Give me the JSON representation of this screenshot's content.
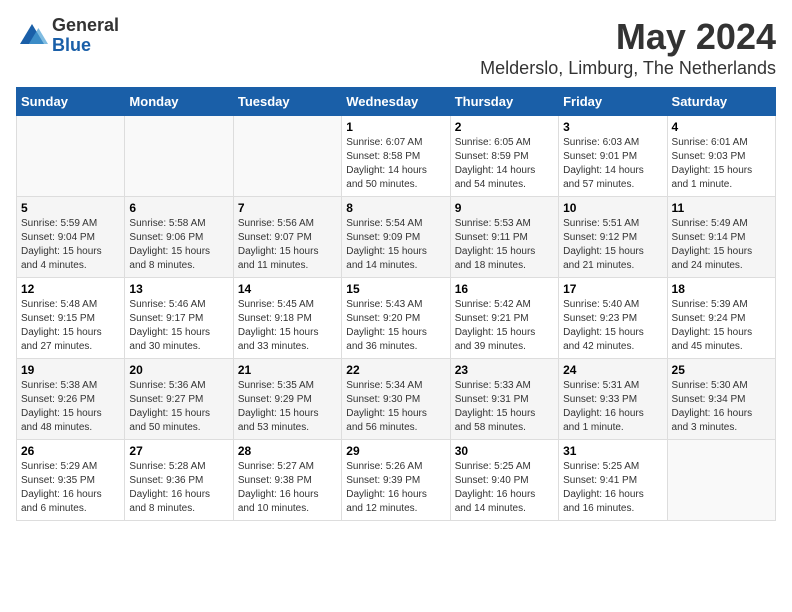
{
  "logo": {
    "general": "General",
    "blue": "Blue"
  },
  "title": "May 2024",
  "subtitle": "Melderslo, Limburg, The Netherlands",
  "days_header": [
    "Sunday",
    "Monday",
    "Tuesday",
    "Wednesday",
    "Thursday",
    "Friday",
    "Saturday"
  ],
  "weeks": [
    [
      {
        "day": "",
        "info": ""
      },
      {
        "day": "",
        "info": ""
      },
      {
        "day": "",
        "info": ""
      },
      {
        "day": "1",
        "info": "Sunrise: 6:07 AM\nSunset: 8:58 PM\nDaylight: 14 hours\nand 50 minutes."
      },
      {
        "day": "2",
        "info": "Sunrise: 6:05 AM\nSunset: 8:59 PM\nDaylight: 14 hours\nand 54 minutes."
      },
      {
        "day": "3",
        "info": "Sunrise: 6:03 AM\nSunset: 9:01 PM\nDaylight: 14 hours\nand 57 minutes."
      },
      {
        "day": "4",
        "info": "Sunrise: 6:01 AM\nSunset: 9:03 PM\nDaylight: 15 hours\nand 1 minute."
      }
    ],
    [
      {
        "day": "5",
        "info": "Sunrise: 5:59 AM\nSunset: 9:04 PM\nDaylight: 15 hours\nand 4 minutes."
      },
      {
        "day": "6",
        "info": "Sunrise: 5:58 AM\nSunset: 9:06 PM\nDaylight: 15 hours\nand 8 minutes."
      },
      {
        "day": "7",
        "info": "Sunrise: 5:56 AM\nSunset: 9:07 PM\nDaylight: 15 hours\nand 11 minutes."
      },
      {
        "day": "8",
        "info": "Sunrise: 5:54 AM\nSunset: 9:09 PM\nDaylight: 15 hours\nand 14 minutes."
      },
      {
        "day": "9",
        "info": "Sunrise: 5:53 AM\nSunset: 9:11 PM\nDaylight: 15 hours\nand 18 minutes."
      },
      {
        "day": "10",
        "info": "Sunrise: 5:51 AM\nSunset: 9:12 PM\nDaylight: 15 hours\nand 21 minutes."
      },
      {
        "day": "11",
        "info": "Sunrise: 5:49 AM\nSunset: 9:14 PM\nDaylight: 15 hours\nand 24 minutes."
      }
    ],
    [
      {
        "day": "12",
        "info": "Sunrise: 5:48 AM\nSunset: 9:15 PM\nDaylight: 15 hours\nand 27 minutes."
      },
      {
        "day": "13",
        "info": "Sunrise: 5:46 AM\nSunset: 9:17 PM\nDaylight: 15 hours\nand 30 minutes."
      },
      {
        "day": "14",
        "info": "Sunrise: 5:45 AM\nSunset: 9:18 PM\nDaylight: 15 hours\nand 33 minutes."
      },
      {
        "day": "15",
        "info": "Sunrise: 5:43 AM\nSunset: 9:20 PM\nDaylight: 15 hours\nand 36 minutes."
      },
      {
        "day": "16",
        "info": "Sunrise: 5:42 AM\nSunset: 9:21 PM\nDaylight: 15 hours\nand 39 minutes."
      },
      {
        "day": "17",
        "info": "Sunrise: 5:40 AM\nSunset: 9:23 PM\nDaylight: 15 hours\nand 42 minutes."
      },
      {
        "day": "18",
        "info": "Sunrise: 5:39 AM\nSunset: 9:24 PM\nDaylight: 15 hours\nand 45 minutes."
      }
    ],
    [
      {
        "day": "19",
        "info": "Sunrise: 5:38 AM\nSunset: 9:26 PM\nDaylight: 15 hours\nand 48 minutes."
      },
      {
        "day": "20",
        "info": "Sunrise: 5:36 AM\nSunset: 9:27 PM\nDaylight: 15 hours\nand 50 minutes."
      },
      {
        "day": "21",
        "info": "Sunrise: 5:35 AM\nSunset: 9:29 PM\nDaylight: 15 hours\nand 53 minutes."
      },
      {
        "day": "22",
        "info": "Sunrise: 5:34 AM\nSunset: 9:30 PM\nDaylight: 15 hours\nand 56 minutes."
      },
      {
        "day": "23",
        "info": "Sunrise: 5:33 AM\nSunset: 9:31 PM\nDaylight: 15 hours\nand 58 minutes."
      },
      {
        "day": "24",
        "info": "Sunrise: 5:31 AM\nSunset: 9:33 PM\nDaylight: 16 hours\nand 1 minute."
      },
      {
        "day": "25",
        "info": "Sunrise: 5:30 AM\nSunset: 9:34 PM\nDaylight: 16 hours\nand 3 minutes."
      }
    ],
    [
      {
        "day": "26",
        "info": "Sunrise: 5:29 AM\nSunset: 9:35 PM\nDaylight: 16 hours\nand 6 minutes."
      },
      {
        "day": "27",
        "info": "Sunrise: 5:28 AM\nSunset: 9:36 PM\nDaylight: 16 hours\nand 8 minutes."
      },
      {
        "day": "28",
        "info": "Sunrise: 5:27 AM\nSunset: 9:38 PM\nDaylight: 16 hours\nand 10 minutes."
      },
      {
        "day": "29",
        "info": "Sunrise: 5:26 AM\nSunset: 9:39 PM\nDaylight: 16 hours\nand 12 minutes."
      },
      {
        "day": "30",
        "info": "Sunrise: 5:25 AM\nSunset: 9:40 PM\nDaylight: 16 hours\nand 14 minutes."
      },
      {
        "day": "31",
        "info": "Sunrise: 5:25 AM\nSunset: 9:41 PM\nDaylight: 16 hours\nand 16 minutes."
      },
      {
        "day": "",
        "info": ""
      }
    ]
  ]
}
